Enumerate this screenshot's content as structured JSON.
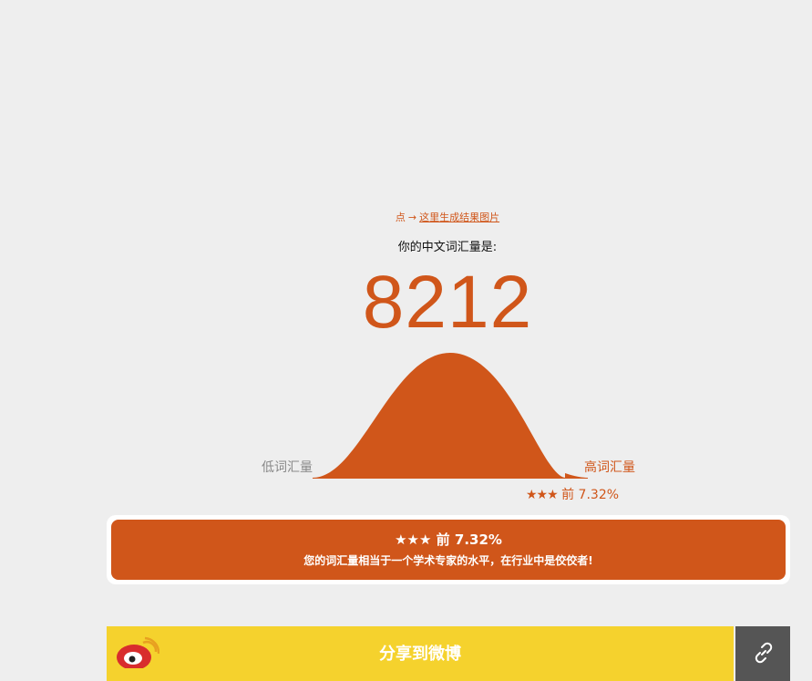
{
  "generate_image": {
    "prefix": "点",
    "arrow": "→",
    "link_text": "这里生成结果图片"
  },
  "result": {
    "label": "你的中文词汇量是:",
    "score": "8212"
  },
  "distribution": {
    "low_label": "低词汇量",
    "high_label": "高词汇量",
    "marker_stars": "★★★",
    "marker_rank": "前 7.32%",
    "top_percent": 7.32
  },
  "rank_card": {
    "stars": "★★★",
    "title": "前 7.32%",
    "description": "您的词汇量相当于一个学术专家的水平，在行业中是佼佼者!"
  },
  "share": {
    "weibo_label": "分享到微博",
    "icons": [
      "weibo-icon",
      "link-icon"
    ]
  },
  "colors": {
    "accent": "#d0561a",
    "background": "#eeeeee",
    "weibo_button": "#f5d22d",
    "link_button": "#555555",
    "low_label": "#888888"
  }
}
